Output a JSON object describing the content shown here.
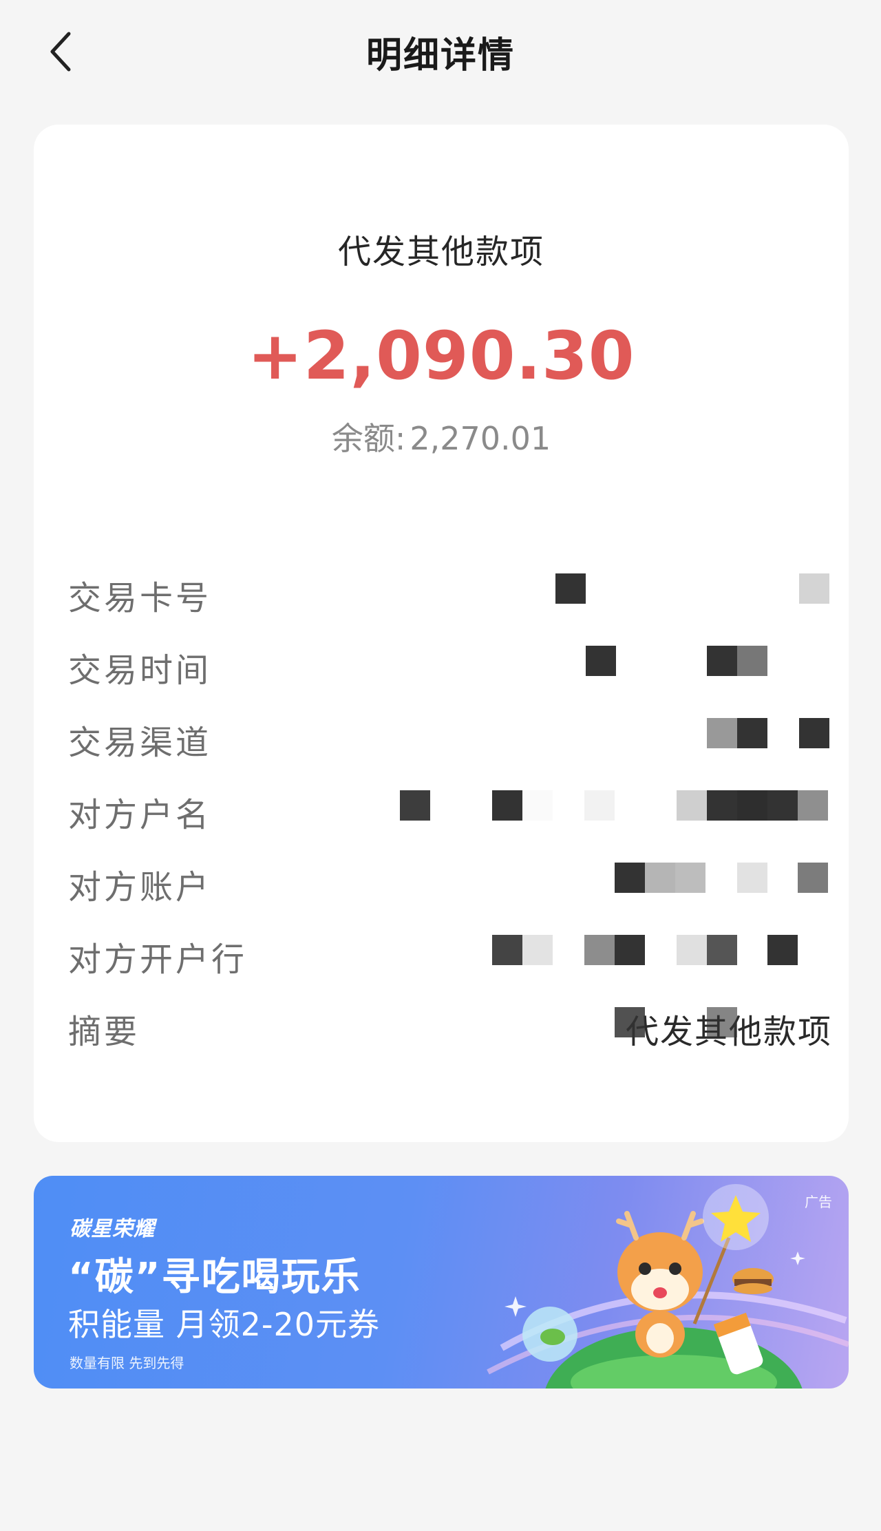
{
  "header": {
    "title": "明细详情",
    "back_icon": "chevron-left-icon"
  },
  "detail": {
    "transaction_type": "代发其他款项",
    "amount": "+2,090.30",
    "balance_label": "余额:",
    "balance_value": "2,270.01",
    "rows": [
      {
        "label": "交易卡号",
        "value": ""
      },
      {
        "label": "交易时间",
        "value": ""
      },
      {
        "label": "交易渠道",
        "value": ""
      },
      {
        "label": "对方户名",
        "value": ""
      },
      {
        "label": "对方账户",
        "value": ""
      },
      {
        "label": "对方开户行",
        "value": ""
      },
      {
        "label": "摘要",
        "value": "代发其他款项"
      }
    ]
  },
  "ad": {
    "tag": "广告",
    "brand": "碳星荣耀",
    "headline": "“碳”寻吃喝玩乐",
    "subline": "积能量 月领2-20元券",
    "note": "数量有限 先到先得"
  },
  "colors": {
    "amount": "#e05a57",
    "background": "#f5f5f5",
    "card": "#ffffff",
    "ad_gradient_start": "#4f8ef5",
    "ad_gradient_end": "#b9a6f1"
  }
}
